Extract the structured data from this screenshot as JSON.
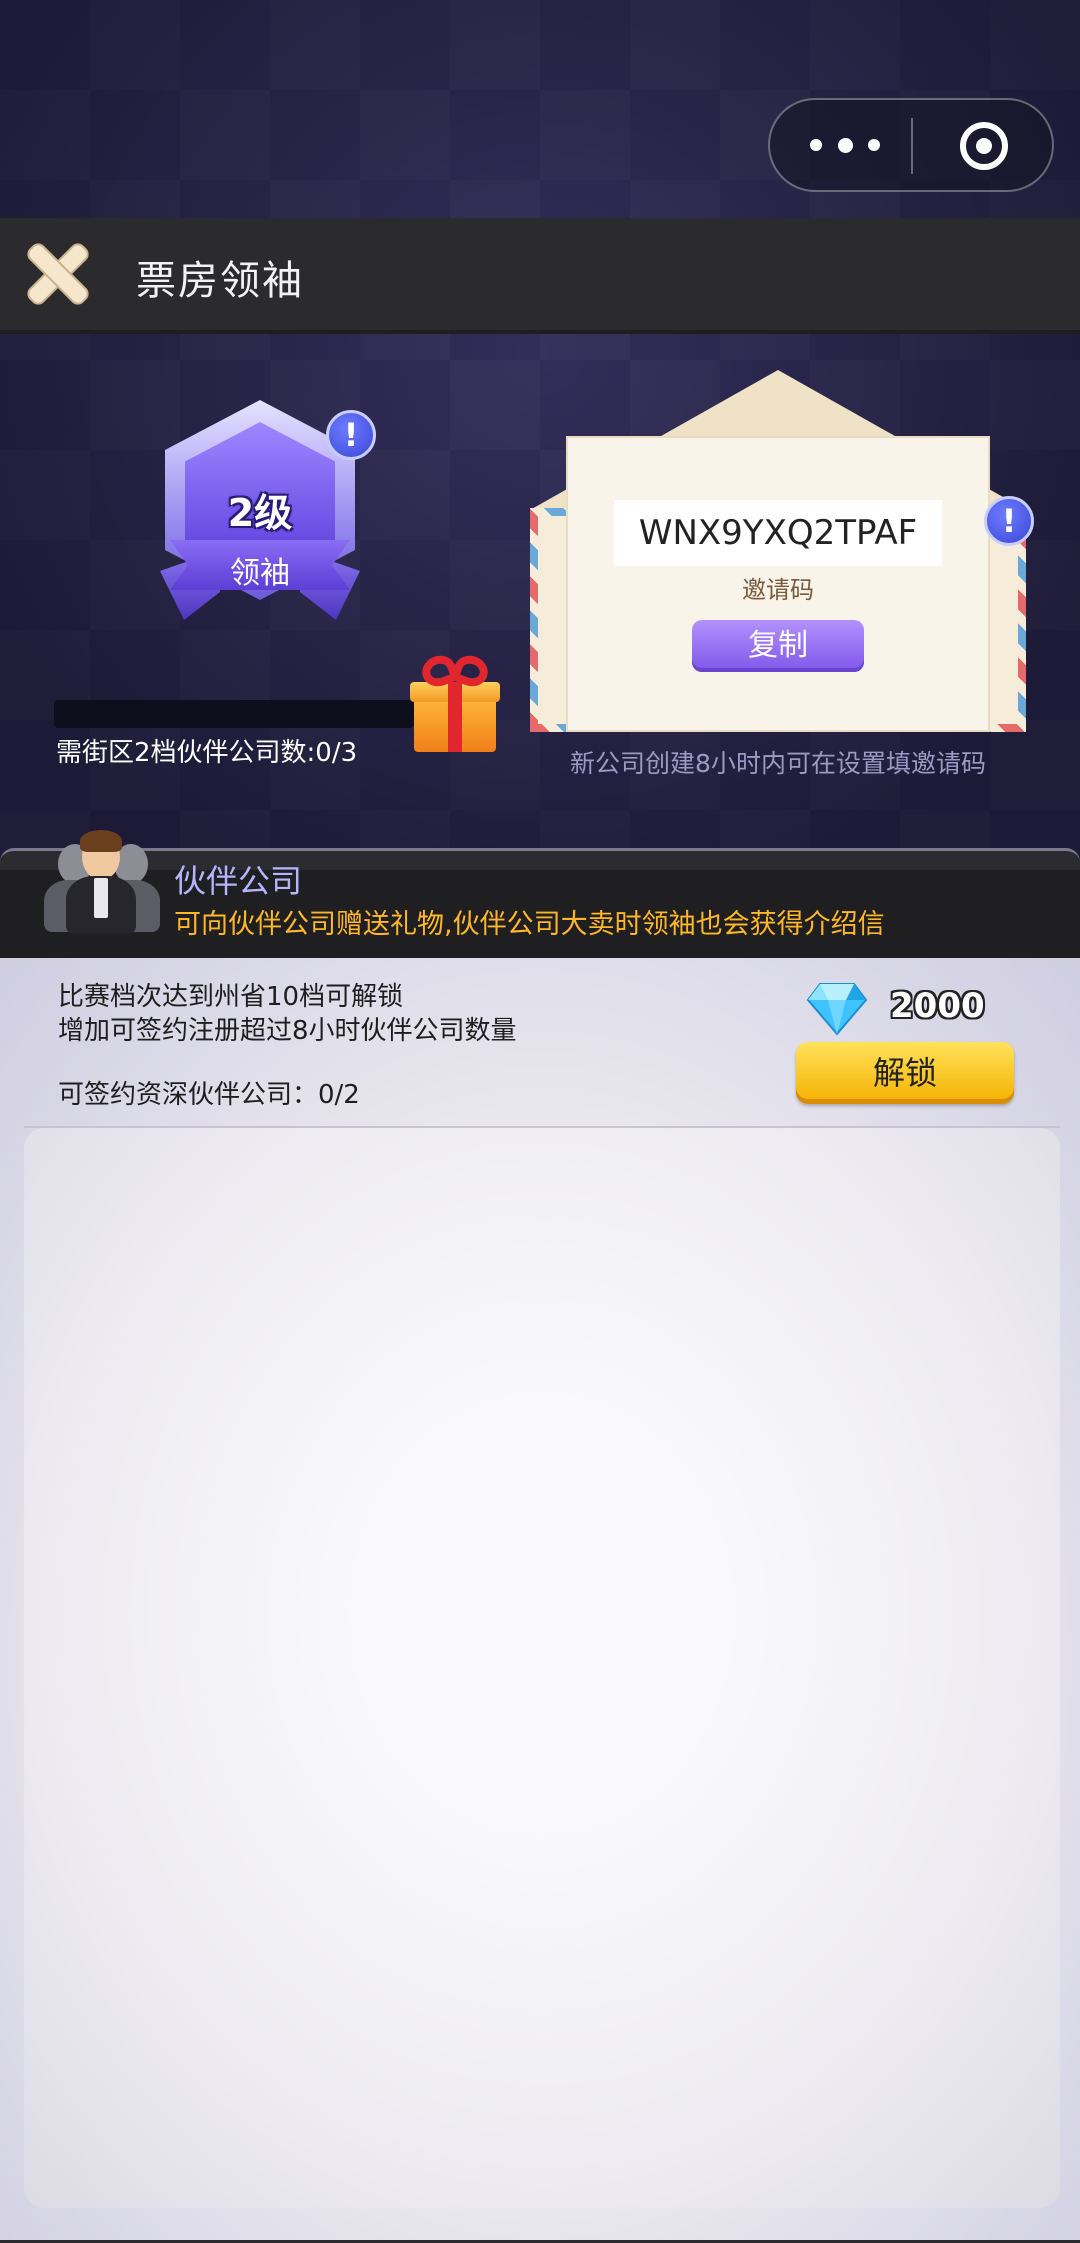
{
  "header": {
    "title": "票房领袖"
  },
  "badge": {
    "level": "2级",
    "rank": "领袖"
  },
  "progress": {
    "fraction": 0.0,
    "requirement_text": "需街区2档伙伴公司数:0/3"
  },
  "invite": {
    "code": "WNX9YXQ2TPAF",
    "label": "邀请码",
    "copy_label": "复制",
    "note": "新公司创建8小时内可在设置填邀请码"
  },
  "partner": {
    "title": "伙伴公司",
    "description": "可向伙伴公司赠送礼物,伙伴公司大卖时领袖也会获得介绍信"
  },
  "unlock_item": {
    "line1": "比赛档次达到州省10档可解锁",
    "line2": "增加可签约注册超过8小时伙伴公司数量",
    "line3": "可签约资深伙伴公司：0/2",
    "price": "2000",
    "unlock_label": "解锁"
  },
  "info_icon_glyph": "!",
  "colors": {
    "accent_purple": "#7f57e8",
    "partner_title": "#b8b3ff",
    "partner_desc": "#ffb629",
    "unlock_button": "#f4b100"
  }
}
